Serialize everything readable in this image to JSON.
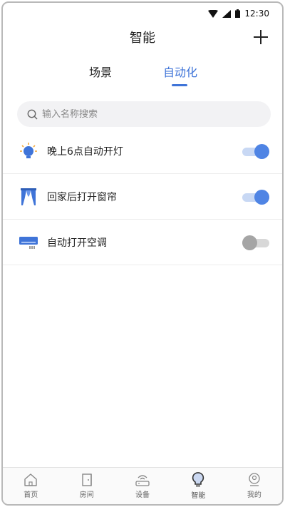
{
  "status_bar": {
    "time": "12:30"
  },
  "header": {
    "title": "智能"
  },
  "tabs": [
    {
      "label": "场景",
      "active": false
    },
    {
      "label": "自动化",
      "active": true
    }
  ],
  "search": {
    "placeholder": "输入名称搜索"
  },
  "automations": [
    {
      "label": "晚上6点自动开灯",
      "icon": "light-bulb-icon",
      "enabled": true
    },
    {
      "label": "回家后打开窗帘",
      "icon": "curtain-icon",
      "enabled": true
    },
    {
      "label": "自动打开空调",
      "icon": "air-conditioner-icon",
      "enabled": false
    }
  ],
  "bottom_nav": [
    {
      "label": "首页",
      "icon": "home-icon"
    },
    {
      "label": "房间",
      "icon": "door-icon"
    },
    {
      "label": "设备",
      "icon": "router-icon"
    },
    {
      "label": "智能",
      "icon": "smart-bulb-icon",
      "active": true
    },
    {
      "label": "我的",
      "icon": "profile-icon"
    }
  ],
  "colors": {
    "accent": "#3f74d8",
    "toggle_on": "#4f84e4",
    "toggle_off": "#a5a5a5"
  }
}
